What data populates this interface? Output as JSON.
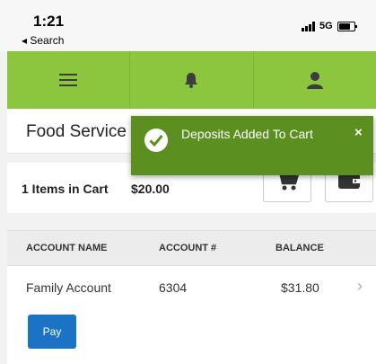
{
  "status_bar": {
    "time": "1:21",
    "back_label": "◂ Search",
    "network": "5G"
  },
  "nav": {
    "icons": [
      "menu-icon",
      "bell-icon",
      "user-icon"
    ],
    "accent": "#8cc63f"
  },
  "page": {
    "title": "Food Service"
  },
  "cart": {
    "items_label": "1 Items in Cart",
    "total": "$20.00",
    "icons": [
      "cart-icon",
      "wallet-icon"
    ]
  },
  "table": {
    "headers": [
      "ACCOUNT NAME",
      "ACCOUNT #",
      "BALANCE"
    ],
    "rows": [
      {
        "name": "Family Account",
        "number": "6304",
        "balance": "$31.80"
      }
    ]
  },
  "pay_label": "Pay",
  "toast": {
    "message": "Deposits Added To Cart",
    "close": "×",
    "color": "#5b8f1f"
  }
}
